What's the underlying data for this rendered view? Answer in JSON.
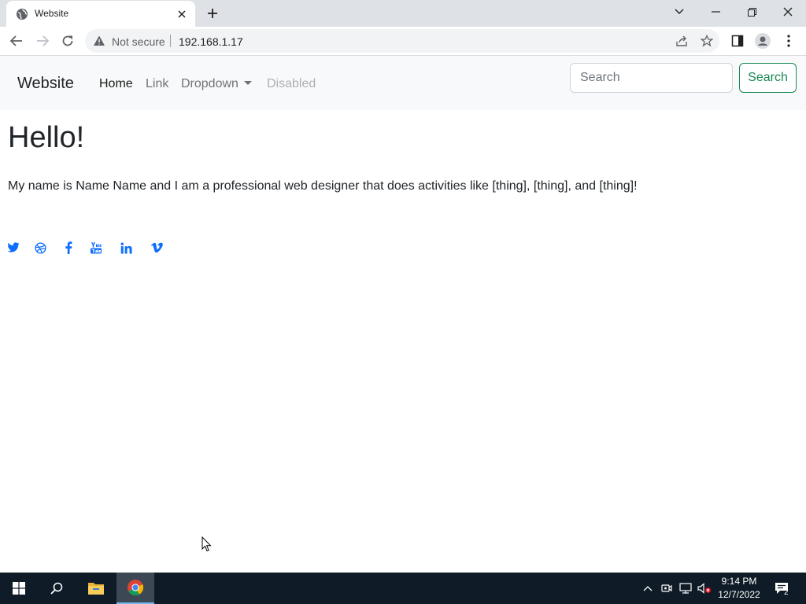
{
  "browser": {
    "tab_title": "Website",
    "security_label": "Not secure",
    "url": "192.168.1.17"
  },
  "navbar": {
    "brand": "Website",
    "links": [
      {
        "label": "Home",
        "state": "active"
      },
      {
        "label": "Link",
        "state": "normal"
      },
      {
        "label": "Dropdown",
        "state": "dropdown"
      },
      {
        "label": "Disabled",
        "state": "disabled"
      }
    ],
    "search_placeholder": "Search",
    "search_button": "Search"
  },
  "content": {
    "heading": "Hello!",
    "intro": "My name is Name Name and I am a professional web designer that does activities like [thing], [thing], and [thing]!",
    "social_icons": [
      "twitter-icon",
      "dribbble-icon",
      "facebook-icon",
      "youtube-icon",
      "linkedin-icon",
      "vimeo-icon"
    ]
  },
  "taskbar": {
    "time": "9:14 PM",
    "date": "12/7/2022",
    "notifications": "2"
  },
  "colors": {
    "accent": "#0d6efd",
    "success": "#198754",
    "navbar_bg": "#f8f9fa",
    "taskbar_bg": "#0f1b26"
  }
}
